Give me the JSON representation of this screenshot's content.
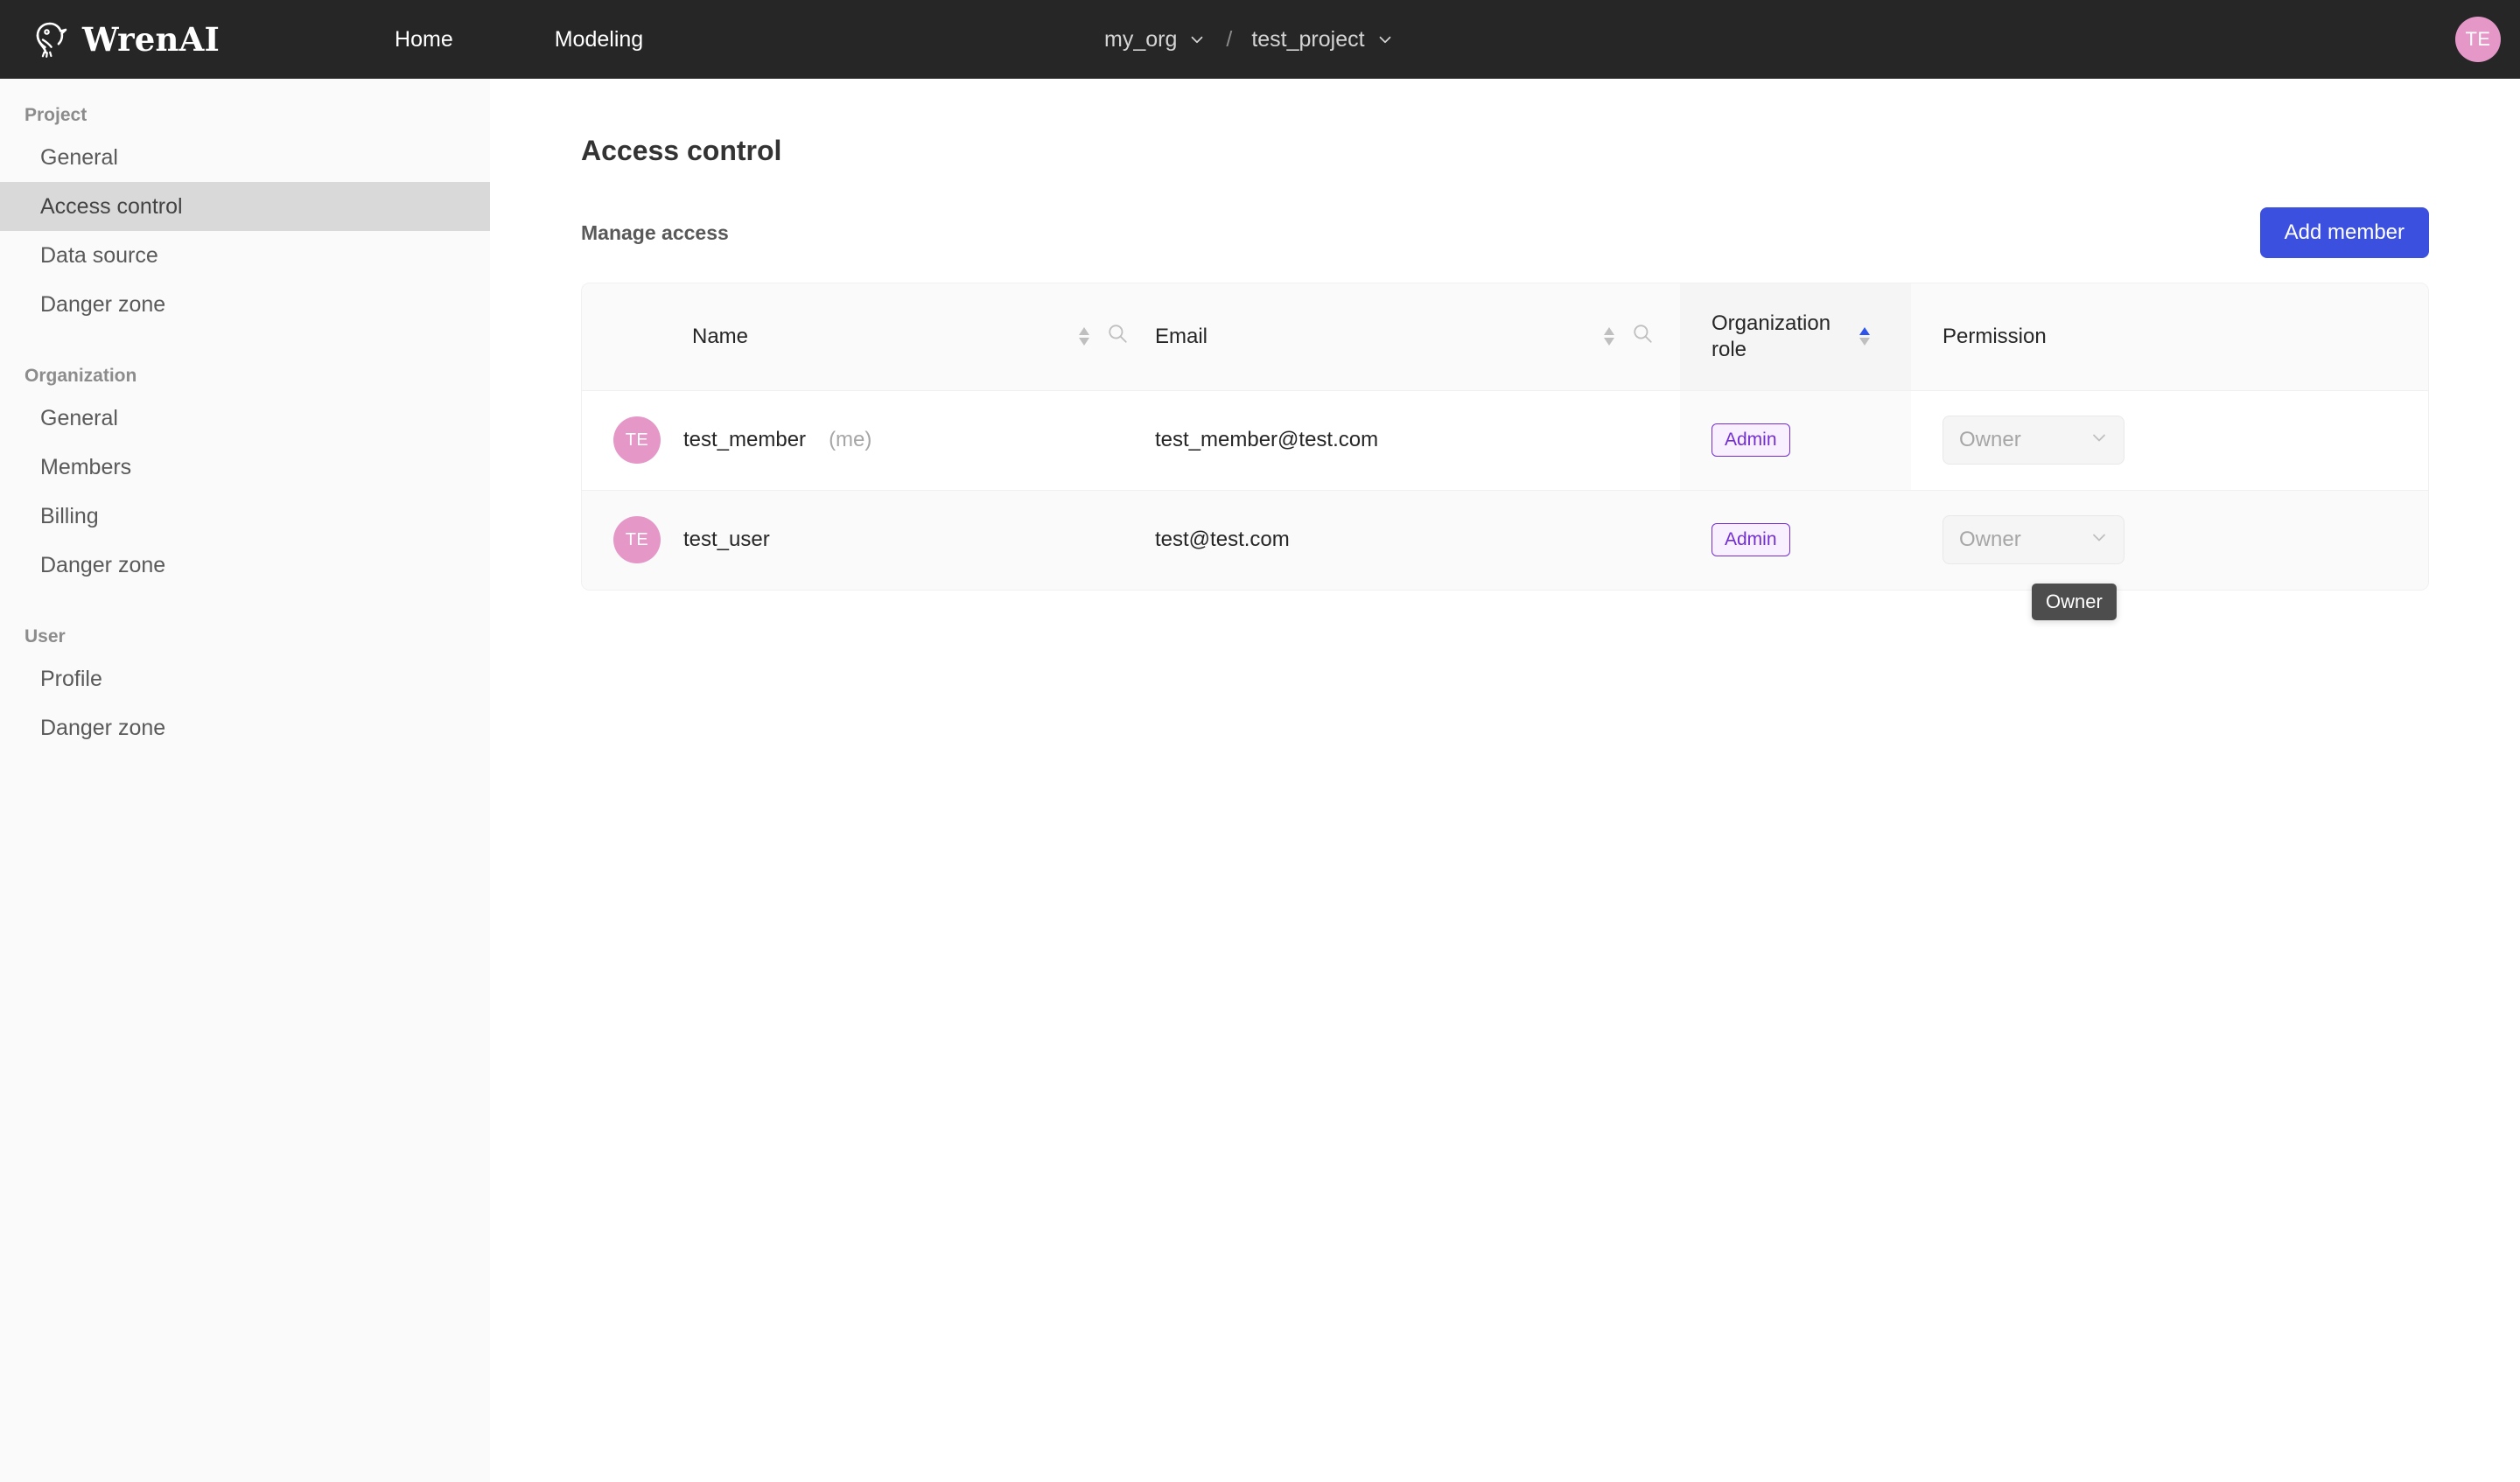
{
  "header": {
    "brand": "WrenAI",
    "logo_icon": "wren-bird-logo-icon",
    "nav": [
      {
        "label": "Home"
      },
      {
        "label": "Modeling"
      }
    ],
    "breadcrumb": {
      "org": "my_org",
      "separator": "/",
      "project": "test_project",
      "org_chevron_icon": "chevron-down-icon",
      "project_chevron_icon": "chevron-down-icon"
    },
    "avatar": {
      "initials": "TE",
      "color": "#e597c8"
    }
  },
  "sidebar": {
    "groups": [
      {
        "title": "Project",
        "items": [
          {
            "label": "General",
            "active": false
          },
          {
            "label": "Access control",
            "active": true
          },
          {
            "label": "Data source",
            "active": false
          },
          {
            "label": "Danger zone",
            "active": false
          }
        ]
      },
      {
        "title": "Organization",
        "items": [
          {
            "label": "General",
            "active": false
          },
          {
            "label": "Members",
            "active": false
          },
          {
            "label": "Billing",
            "active": false
          },
          {
            "label": "Danger zone",
            "active": false
          }
        ]
      },
      {
        "title": "User",
        "items": [
          {
            "label": "Profile",
            "active": false
          },
          {
            "label": "Danger zone",
            "active": false
          }
        ]
      }
    ]
  },
  "main": {
    "page_title": "Access control",
    "section_title": "Manage access",
    "add_member_label": "Add member",
    "accent_color": "#3c50e0"
  },
  "table": {
    "columns": [
      {
        "label": "Name",
        "sortable": true,
        "searchable": true,
        "sorted": "none"
      },
      {
        "label": "Email",
        "sortable": true,
        "searchable": true,
        "sorted": "none"
      },
      {
        "label": "Organization role",
        "sortable": true,
        "searchable": false,
        "sorted": "ascending"
      },
      {
        "label": "Permission",
        "sortable": false,
        "searchable": false,
        "sorted": "none"
      }
    ],
    "rows": [
      {
        "avatar_initials": "TE",
        "name": "test_member",
        "name_suffix": "(me)",
        "email": "test_member@test.com",
        "org_role": "Admin",
        "permission": "Owner",
        "permission_disabled": true
      },
      {
        "avatar_initials": "TE",
        "name": "test_user",
        "name_suffix": "",
        "email": "test@test.com",
        "org_role": "Admin",
        "permission": "Owner",
        "permission_disabled": true
      }
    ]
  },
  "tooltip": {
    "text": "Owner"
  },
  "icons": {
    "sort_icon": "sort-arrows-icon",
    "search_icon": "search-icon",
    "select_chevron_icon": "chevron-down-icon"
  }
}
